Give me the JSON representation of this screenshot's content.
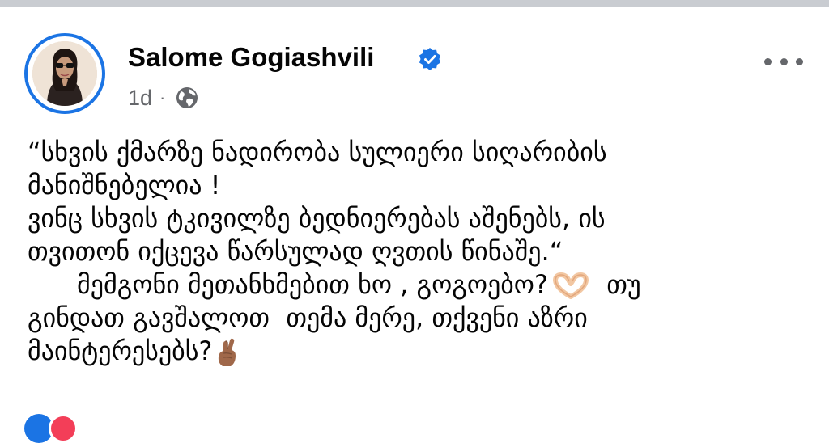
{
  "post": {
    "author": "Salome Gogiashvili",
    "time": "1d",
    "separator": "·",
    "audience_icon": "globe-icon",
    "verified_icon": "verified-badge-icon",
    "more_icon": "more-options-icon",
    "accent_color": "#1b74e4",
    "body_lines": [
      "“სხვის ქმარზე ნადირობა სულიერი სიღარიბის",
      "მანიშნებელია !",
      "ვინც სხვის ტკივილზე ბედნიერებას აშენებს, ის",
      "თვითონ იქცევა წარსულად ღვთის წინაშე.“",
      "      მემგონი მეთანხმებით ხო , გოგოებო?",
      "  თუ",
      "გინდათ გავშალოთ  თემა მერე, თქვენი აზრი",
      "მაინტერესებს?"
    ],
    "emojis": [
      "heart-hands-emoji",
      "crossed-fingers-emoji"
    ]
  }
}
